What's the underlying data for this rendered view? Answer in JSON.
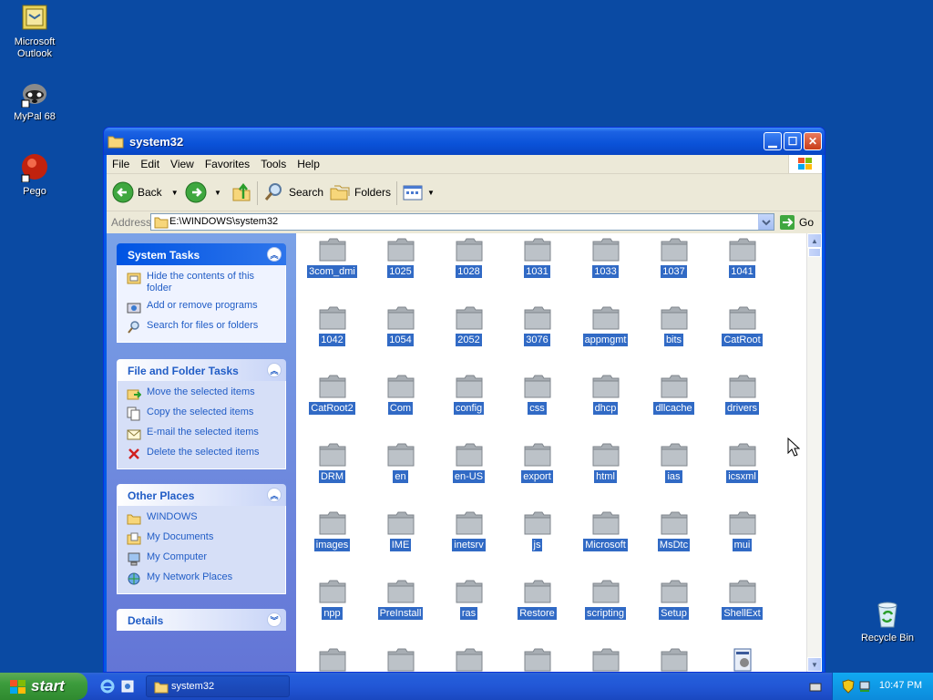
{
  "desktop": {
    "icons": [
      {
        "label_1": "Microsoft",
        "label_2": "Outlook"
      },
      {
        "label_1": "MyPal 68"
      },
      {
        "label_1": "Pego"
      },
      {
        "label_1": "Recycle Bin"
      }
    ]
  },
  "window": {
    "title": "system32",
    "menu": [
      "File",
      "Edit",
      "View",
      "Favorites",
      "Tools",
      "Help"
    ],
    "toolbar": {
      "back": "Back",
      "search": "Search",
      "folders": "Folders"
    },
    "address": {
      "label": "Address",
      "value": "E:\\WINDOWS\\system32",
      "go": "Go"
    }
  },
  "taskpane": {
    "system_tasks": {
      "title": "System Tasks",
      "items": [
        "Hide the contents of this folder",
        "Add or remove programs",
        "Search for files or folders"
      ]
    },
    "file_folder_tasks": {
      "title": "File and Folder Tasks",
      "items": [
        "Move the selected items",
        "Copy the selected items",
        "E-mail the selected items",
        "Delete the selected items"
      ]
    },
    "other_places": {
      "title": "Other Places",
      "items": [
        "WINDOWS",
        "My Documents",
        "My Computer",
        "My Network Places"
      ]
    },
    "details": {
      "title": "Details"
    }
  },
  "folders": [
    "3com_dmi",
    "1025",
    "1028",
    "1031",
    "1033",
    "1037",
    "1041",
    "1042",
    "1054",
    "2052",
    "3076",
    "appmgmt",
    "bits",
    "CatRoot",
    "CatRoot2",
    "Com",
    "config",
    "css",
    "dhcp",
    "dllcache",
    "drivers",
    "DRM",
    "en",
    "en-US",
    "export",
    "html",
    "ias",
    "icsxml",
    "images",
    "IME",
    "inetsrv",
    "js",
    "Microsoft",
    "MsDtc",
    "mui",
    "npp",
    "PreInstall",
    "ras",
    "Restore",
    "scripting",
    "Setup",
    "ShellExt"
  ],
  "taskbar": {
    "start": "start",
    "task": "system32",
    "clock": "10:47 PM"
  },
  "colors": {
    "desktop": "#0a4aa3",
    "selection": "#316ac5",
    "taskpane_link": "#215dc6"
  }
}
